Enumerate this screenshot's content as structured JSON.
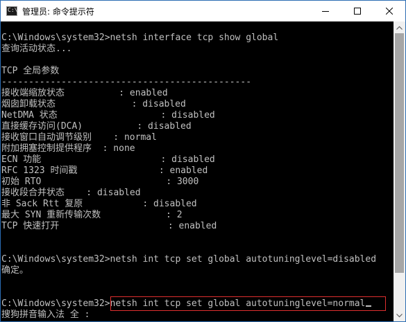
{
  "window": {
    "title": "管理员: 命令提示符",
    "icon_prompt": "C:\\",
    "controls": [
      "minimize-icon",
      "maximize-icon",
      "close-icon"
    ]
  },
  "console": {
    "lines": [
      "",
      "C:\\Windows\\system32>netsh interface tcp show global",
      "查询活动状态...",
      "",
      "TCP 全局参数",
      "----------------------------------------------",
      "接收端缩放状态          : enabled",
      "烟囱卸载状态              : disabled",
      "NetDMA 状态                   : disabled",
      "直接缓存访问(DCA)          : disabled",
      "接收窗口自动调节级别    : normal",
      "附加拥塞控制提供程序  : none",
      "ECN 功能                      : disabled",
      "RFC 1323 时间戳               : enabled",
      "初始 RTO                       : 3000",
      "接收段合并状态    : disabled",
      "非 Sack Rtt 复原           : disabled",
      "最大 SYN 重新传输次数            : 2",
      "TCP 快速打开                    : enabled",
      "",
      "",
      "C:\\Windows\\system32>netsh int tcp set global autotuninglevel=disabled",
      "确定。",
      "",
      "",
      "C:\\Windows\\system32>netsh int tcp set global autotuninglevel=normal",
      "搜狗拼音输入法 全 :"
    ],
    "text_color": "#c0c0c0",
    "background": "#000000",
    "highlight_color": "#e02f2f"
  },
  "scrollbar": {
    "up_icon": "scroll-up-arrow-icon",
    "down_icon": "scroll-down-arrow-icon"
  }
}
